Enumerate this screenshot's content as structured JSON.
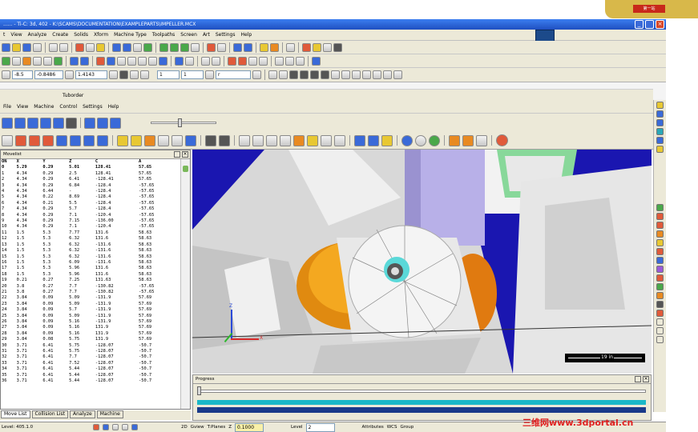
{
  "title": "...... - Ti-C: 3d, 402 - K:\\SCAMS\\DOCUMENTATION\\EXAMPLEPARTS\\IMPELLER.MCX",
  "main_menu": [
    "t",
    "View",
    "Analyze",
    "Create",
    "Solids",
    "Xform",
    "Machine Type",
    "Toolpaths",
    "Screen",
    "Art",
    "Settings",
    "Help"
  ],
  "toolbar3": {
    "combo1": "-8.5",
    "combo2": "-0.8486",
    "combo3": "1.4143",
    "combo4": "1",
    "combo5": "1",
    "combo6": "r"
  },
  "sim_title": "Tuborder",
  "sim_menu": [
    "File",
    "View",
    "Machine",
    "Control",
    "Settings",
    "Help"
  ],
  "move_list": {
    "panel_title": "Movelist",
    "headers": [
      "ON",
      "X",
      "Y",
      "Z",
      "C",
      "A"
    ],
    "first_row": [
      "0",
      "5.29",
      "0.29",
      "5.01",
      "128.41",
      "57.65"
    ],
    "rows": [
      [
        "1",
        "4.34",
        "0.29",
        "2.5",
        "128.41",
        "57.65"
      ],
      [
        "2",
        "4.34",
        "0.29",
        "6.41",
        "-128.41",
        "57.65"
      ],
      [
        "3",
        "4.34",
        "0.29",
        "6.84",
        "-128.4",
        "-57.65"
      ],
      [
        "4",
        "4.34",
        "6.44",
        "-",
        "-128.4",
        "-57.65"
      ],
      [
        "5",
        "4.34",
        "0.22",
        "8.69",
        "-128.4",
        "-57.65"
      ],
      [
        "6",
        "4.34",
        "0.21",
        "5.5",
        "-128.4",
        "-57.65"
      ],
      [
        "7",
        "4.34",
        "0.29",
        "5.7",
        "-128.4",
        "-57.65"
      ],
      [
        "8",
        "4.34",
        "0.29",
        "7.1",
        "-120.4",
        "-57.65"
      ],
      [
        "9",
        "4.34",
        "0.29",
        "7.15",
        "-136.00",
        "-57.65"
      ],
      [
        "10",
        "4.34",
        "0.29",
        "7.1",
        "-120.4",
        "-57.65"
      ],
      [
        "11",
        "1.5",
        "5.3",
        "7.77",
        "131.6",
        "58.63"
      ],
      [
        "12",
        "1.5",
        "5.3",
        "6.32",
        "131.6",
        "58.63"
      ],
      [
        "13",
        "1.5",
        "5.3",
        "6.32",
        "-131.6",
        "58.63"
      ],
      [
        "14",
        "1.5",
        "5.3",
        "6.32",
        "-131.6",
        "58.63"
      ],
      [
        "15",
        "1.5",
        "5.3",
        "6.32",
        "-131.6",
        "58.63"
      ],
      [
        "16",
        "1.5",
        "5.3",
        "6.09",
        "-131.6",
        "58.63"
      ],
      [
        "17",
        "1.5",
        "5.3",
        "5.96",
        "131.6",
        "58.63"
      ],
      [
        "18",
        "1.5",
        "5.3",
        "5.96",
        "131.6",
        "58.63"
      ],
      [
        "19",
        "0.21",
        "0.27",
        "7.25",
        "131.63",
        "58.63"
      ],
      [
        "20",
        "3.8",
        "0.27",
        "7.7",
        "-130.82",
        "-57.65"
      ],
      [
        "21",
        "3.8",
        "0.27",
        "7.7",
        "-130.82",
        "-57.65"
      ],
      [
        "22",
        "3.84",
        "0.09",
        "5.09",
        "-131.9",
        "57.69"
      ],
      [
        "23",
        "3.84",
        "0.09",
        "5.09",
        "-131.9",
        "57.69"
      ],
      [
        "24",
        "3.84",
        "0.09",
        "5.7",
        "-131.9",
        "57.69"
      ],
      [
        "25",
        "3.84",
        "0.09",
        "5.09",
        "-131.9",
        "57.69"
      ],
      [
        "26",
        "3.84",
        "0.09",
        "5.16",
        "-131.9",
        "57.69"
      ],
      [
        "27",
        "3.84",
        "0.09",
        "5.16",
        "131.9",
        "57.69"
      ],
      [
        "28",
        "3.84",
        "0.09",
        "5.16",
        "131.9",
        "57.69"
      ],
      [
        "29",
        "3.84",
        "0.08",
        "5.75",
        "131.9",
        "57.69"
      ],
      [
        "30",
        "3.71",
        "6.41",
        "5.75",
        "-128.07",
        "-50.7"
      ],
      [
        "31",
        "3.71",
        "6.41",
        "5.75",
        "-128.07",
        "-50.7"
      ],
      [
        "32",
        "3.71",
        "6.41",
        "7.7",
        "-128.07",
        "-50.7"
      ],
      [
        "33",
        "3.71",
        "6.41",
        "7.52",
        "-128.07",
        "-50.7"
      ],
      [
        "34",
        "3.71",
        "6.41",
        "5.44",
        "-128.07",
        "-50.7"
      ],
      [
        "35",
        "3.71",
        "6.41",
        "5.44",
        "-128.07",
        "-50.7"
      ],
      [
        "36",
        "3.71",
        "6.41",
        "5.44",
        "-128.07",
        "-50.7"
      ]
    ]
  },
  "tabs": [
    "Move List",
    "Collision List",
    "Analyze",
    "Machine"
  ],
  "scale_label": "19 in",
  "axis": {
    "x": "X",
    "y": "Y",
    "z": "Z"
  },
  "slider_panel_title": "Progress",
  "status": {
    "coords": "Level: 405.1.0",
    "d1": "2D",
    "d2": "Gview",
    "d3": "T:Planes",
    "d4": "Z",
    "d5": "0.1000",
    "d6": "Level",
    "d7": "2",
    "d8": "Attributes",
    "d9": "WCS",
    "d10": "Group"
  },
  "watermark": "三维网www.3dportal.cn",
  "colors": {
    "viewport_bg": "#1a16b0",
    "xp_blue": "#1f4fc0",
    "panel_bg": "#ece9d8"
  }
}
